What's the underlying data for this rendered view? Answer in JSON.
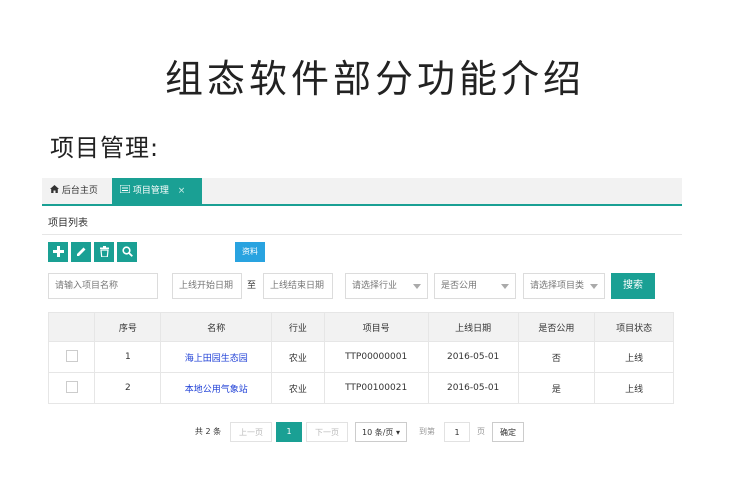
{
  "title": "组态软件部分功能介绍",
  "subtitle": "项目管理:",
  "tabs": {
    "home_label": "后台主页",
    "active_label": "项目管理",
    "close": "×"
  },
  "section_title": "项目列表",
  "toolbar": {
    "add_icon": "plus-icon",
    "edit_icon": "pencil-icon",
    "delete_icon": "trash-icon",
    "search_icon": "search-icon",
    "tag_label": "资料"
  },
  "filters": {
    "name_placeholder": "请输入项目名称",
    "start_date_placeholder": "上线开始日期",
    "to_label": "至",
    "end_date_placeholder": "上线结束日期",
    "industry_placeholder": "请选择行业",
    "public_placeholder": "是否公用",
    "type_placeholder": "请选择项目类",
    "search_label": "搜索"
  },
  "table": {
    "headers": [
      "",
      "序号",
      "名称",
      "行业",
      "项目号",
      "上线日期",
      "是否公用",
      "项目状态"
    ],
    "rows": [
      {
        "no": "1",
        "name": "海上田园生态园",
        "industry": "农业",
        "code": "TTP00000001",
        "date": "2016-05-01",
        "public": "否",
        "status": "上线"
      },
      {
        "no": "2",
        "name": "本地公用气象站",
        "industry": "农业",
        "code": "TTP00100021",
        "date": "2016-05-01",
        "public": "是",
        "status": "上线"
      }
    ]
  },
  "pager": {
    "total": "共 2 条",
    "prev": "上一页",
    "current": "1",
    "next": "下一页",
    "size": "10 条/页 ▾",
    "goto": "到第",
    "page_input": "1",
    "page_unit": "页",
    "confirm": "确定"
  },
  "colors": {
    "accent": "#1aa094",
    "tag_blue": "#29a3e0",
    "link": "#1e3fd6"
  }
}
